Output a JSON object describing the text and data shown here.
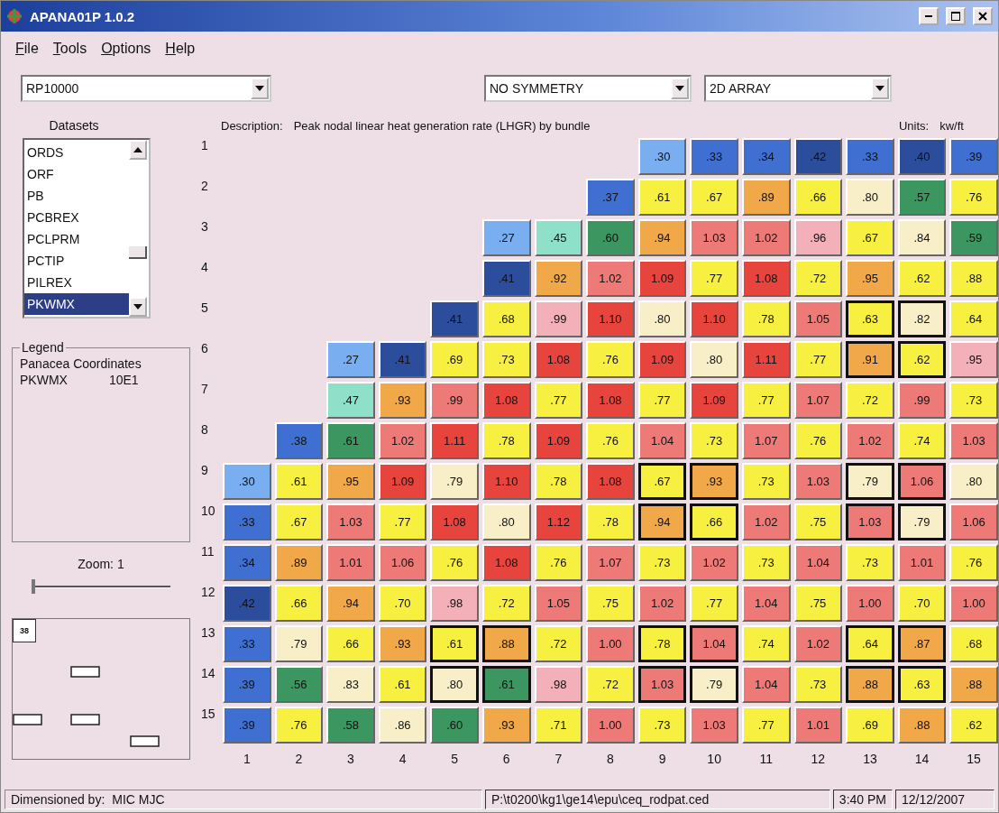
{
  "window": {
    "title": "APANA01P 1.0.2"
  },
  "menu": [
    "File",
    "Tools",
    "Options",
    "Help"
  ],
  "selectors": [
    {
      "value": "RP10000"
    },
    {
      "value": "NO SYMMETRY"
    },
    {
      "value": "2D ARRAY"
    }
  ],
  "datasets": {
    "title": "Datasets",
    "items": [
      {
        "label": "ORDS",
        "selected": false
      },
      {
        "label": "ORF",
        "selected": false
      },
      {
        "label": "PB",
        "selected": false
      },
      {
        "label": "PCBREX",
        "selected": false
      },
      {
        "label": "PCLPRM",
        "selected": false
      },
      {
        "label": "PCTIP",
        "selected": false
      },
      {
        "label": "PILREX",
        "selected": false
      },
      {
        "label": "PKWMX",
        "selected": true
      }
    ]
  },
  "legend": {
    "title": "Legend",
    "heading": "Panacea Coordinates",
    "name": "PKWMX",
    "coordinate": "10E1"
  },
  "zoom": {
    "label": "Zoom:  1",
    "level": 0
  },
  "minimap": {
    "label": "38"
  },
  "description": {
    "label": "Description:",
    "text": "Peak nodal linear heat generation rate (LHGR) by bundle",
    "units_label": "Units:",
    "units": "kw/ft"
  },
  "grid": {
    "rows": [
      {
        "label": "1",
        "cells": [
          "",
          "",
          "",
          "",
          "",
          "",
          "",
          "",
          {
            "value": ".30",
            "color": "#79aef0",
            "outlined": false
          },
          {
            "value": ".33",
            "color": "#3f6fd0",
            "outlined": false
          },
          {
            "value": ".34",
            "color": "#3f6fd0",
            "outlined": false
          },
          {
            "value": ".42",
            "color": "#2c4c9c",
            "outlined": false
          },
          {
            "value": ".33",
            "color": "#3f6fd0",
            "outlined": false
          },
          {
            "value": ".40",
            "color": "#2c4c9c",
            "outlined": false
          },
          {
            "value": ".39",
            "color": "#3f6fd0",
            "outlined": false
          }
        ]
      },
      {
        "label": "2",
        "cells": [
          "",
          "",
          "",
          "",
          "",
          "",
          "",
          {
            "value": ".37",
            "color": "#3f6fd0",
            "outlined": false
          },
          {
            "value": ".61",
            "color": "#f8f040",
            "outlined": false
          },
          {
            "value": ".67",
            "color": "#f8f040",
            "outlined": false
          },
          {
            "value": ".89",
            "color": "#f0a848",
            "outlined": false
          },
          {
            "value": ".66",
            "color": "#f8f040",
            "outlined": false
          },
          {
            "value": ".80",
            "color": "#f8efc8",
            "outlined": false
          },
          {
            "value": ".57",
            "color": "#3c9660",
            "outlined": false
          },
          {
            "value": ".76",
            "color": "#f8f040",
            "outlined": false
          }
        ]
      },
      {
        "label": "3",
        "cells": [
          "",
          "",
          "",
          "",
          "",
          {
            "value": ".27",
            "color": "#79aef0",
            "outlined": false
          },
          {
            "value": ".45",
            "color": "#8ee0c8",
            "outlined": false
          },
          {
            "value": ".60",
            "color": "#3c9660",
            "outlined": false
          },
          {
            "value": ".94",
            "color": "#f0a848",
            "outlined": false
          },
          {
            "value": "1.03",
            "color": "#ee7a78",
            "outlined": false
          },
          {
            "value": "1.02",
            "color": "#ee7a78",
            "outlined": false
          },
          {
            "value": ".96",
            "color": "#f4b0b8",
            "outlined": false
          },
          {
            "value": ".67",
            "color": "#f8f040",
            "outlined": false
          },
          {
            "value": ".84",
            "color": "#f8efc8",
            "outlined": false
          },
          {
            "value": ".59",
            "color": "#3c9660",
            "outlined": false
          }
        ]
      },
      {
        "label": "4",
        "cells": [
          "",
          "",
          "",
          "",
          "",
          {
            "value": ".41",
            "color": "#2c4c9c",
            "outlined": false
          },
          {
            "value": ".92",
            "color": "#f0a848",
            "outlined": false
          },
          {
            "value": "1.02",
            "color": "#ee7a78",
            "outlined": false
          },
          {
            "value": "1.09",
            "color": "#e6443c",
            "outlined": false
          },
          {
            "value": ".77",
            "color": "#f8f040",
            "outlined": false
          },
          {
            "value": "1.08",
            "color": "#e6443c",
            "outlined": false
          },
          {
            "value": ".72",
            "color": "#f8f040",
            "outlined": false
          },
          {
            "value": ".95",
            "color": "#f0a848",
            "outlined": false
          },
          {
            "value": ".62",
            "color": "#f8f040",
            "outlined": false
          },
          {
            "value": ".88",
            "color": "#f8f040",
            "outlined": false
          }
        ]
      },
      {
        "label": "5",
        "cells": [
          "",
          "",
          "",
          "",
          {
            "value": ".41",
            "color": "#2c4c9c",
            "outlined": false
          },
          {
            "value": ".68",
            "color": "#f8f040",
            "outlined": false
          },
          {
            "value": ".99",
            "color": "#f4b0b8",
            "outlined": false
          },
          {
            "value": "1.10",
            "color": "#e6443c",
            "outlined": false
          },
          {
            "value": ".80",
            "color": "#f8efc8",
            "outlined": false
          },
          {
            "value": "1.10",
            "color": "#e6443c",
            "outlined": false
          },
          {
            "value": ".78",
            "color": "#f8f040",
            "outlined": false
          },
          {
            "value": "1.05",
            "color": "#ee7a78",
            "outlined": false
          },
          {
            "value": ".63",
            "color": "#f8f040",
            "outlined": true
          },
          {
            "value": ".82",
            "color": "#f8efc8",
            "outlined": true
          },
          {
            "value": ".64",
            "color": "#f8f040",
            "outlined": false
          }
        ]
      },
      {
        "label": "6",
        "cells": [
          "",
          "",
          {
            "value": ".27",
            "color": "#79aef0",
            "outlined": false
          },
          {
            "value": ".41",
            "color": "#2c4c9c",
            "outlined": false
          },
          {
            "value": ".69",
            "color": "#f8f040",
            "outlined": false
          },
          {
            "value": ".73",
            "color": "#f8f040",
            "outlined": false
          },
          {
            "value": "1.08",
            "color": "#e6443c",
            "outlined": false
          },
          {
            "value": ".76",
            "color": "#f8f040",
            "outlined": false
          },
          {
            "value": "1.09",
            "color": "#e6443c",
            "outlined": false
          },
          {
            "value": ".80",
            "color": "#f8efc8",
            "outlined": false
          },
          {
            "value": "1.11",
            "color": "#e6443c",
            "outlined": false
          },
          {
            "value": ".77",
            "color": "#f8f040",
            "outlined": false
          },
          {
            "value": ".91",
            "color": "#f0a848",
            "outlined": true
          },
          {
            "value": ".62",
            "color": "#f8f040",
            "outlined": true
          },
          {
            "value": ".95",
            "color": "#f4b0b8",
            "outlined": false
          }
        ]
      },
      {
        "label": "7",
        "cells": [
          "",
          "",
          {
            "value": ".47",
            "color": "#8ee0c8",
            "outlined": false
          },
          {
            "value": ".93",
            "color": "#f0a848",
            "outlined": false
          },
          {
            "value": ".99",
            "color": "#ee7a78",
            "outlined": false
          },
          {
            "value": "1.08",
            "color": "#e6443c",
            "outlined": false
          },
          {
            "value": ".77",
            "color": "#f8f040",
            "outlined": false
          },
          {
            "value": "1.08",
            "color": "#e6443c",
            "outlined": false
          },
          {
            "value": ".77",
            "color": "#f8f040",
            "outlined": false
          },
          {
            "value": "1.09",
            "color": "#e6443c",
            "outlined": false
          },
          {
            "value": ".77",
            "color": "#f8f040",
            "outlined": false
          },
          {
            "value": "1.07",
            "color": "#ee7a78",
            "outlined": false
          },
          {
            "value": ".72",
            "color": "#f8f040",
            "outlined": false
          },
          {
            "value": ".99",
            "color": "#ee7a78",
            "outlined": false
          },
          {
            "value": ".73",
            "color": "#f8f040",
            "outlined": false
          }
        ]
      },
      {
        "label": "8",
        "cells": [
          "",
          {
            "value": ".38",
            "color": "#3f6fd0",
            "outlined": false
          },
          {
            "value": ".61",
            "color": "#3c9660",
            "outlined": false
          },
          {
            "value": "1.02",
            "color": "#ee7a78",
            "outlined": false
          },
          {
            "value": "1.11",
            "color": "#e6443c",
            "outlined": false
          },
          {
            "value": ".78",
            "color": "#f8f040",
            "outlined": false
          },
          {
            "value": "1.09",
            "color": "#e6443c",
            "outlined": false
          },
          {
            "value": ".76",
            "color": "#f8f040",
            "outlined": false
          },
          {
            "value": "1.04",
            "color": "#ee7a78",
            "outlined": false
          },
          {
            "value": ".73",
            "color": "#f8f040",
            "outlined": false
          },
          {
            "value": "1.07",
            "color": "#ee7a78",
            "outlined": false
          },
          {
            "value": ".76",
            "color": "#f8f040",
            "outlined": false
          },
          {
            "value": "1.02",
            "color": "#ee7a78",
            "outlined": false
          },
          {
            "value": ".74",
            "color": "#f8f040",
            "outlined": false
          },
          {
            "value": "1.03",
            "color": "#ee7a78",
            "outlined": false
          }
        ]
      },
      {
        "label": "9",
        "cells": [
          {
            "value": ".30",
            "color": "#79aef0",
            "outlined": false
          },
          {
            "value": ".61",
            "color": "#f8f040",
            "outlined": false
          },
          {
            "value": ".95",
            "color": "#f0a848",
            "outlined": false
          },
          {
            "value": "1.09",
            "color": "#e6443c",
            "outlined": false
          },
          {
            "value": ".79",
            "color": "#f8efc8",
            "outlined": false
          },
          {
            "value": "1.10",
            "color": "#e6443c",
            "outlined": false
          },
          {
            "value": ".78",
            "color": "#f8f040",
            "outlined": false
          },
          {
            "value": "1.08",
            "color": "#e6443c",
            "outlined": false
          },
          {
            "value": ".67",
            "color": "#f8f040",
            "outlined": true
          },
          {
            "value": ".93",
            "color": "#f0a848",
            "outlined": true
          },
          {
            "value": ".73",
            "color": "#f8f040",
            "outlined": false
          },
          {
            "value": "1.03",
            "color": "#ee7a78",
            "outlined": false
          },
          {
            "value": ".79",
            "color": "#f8efc8",
            "outlined": true
          },
          {
            "value": "1.06",
            "color": "#ee7a78",
            "outlined": true
          },
          {
            "value": ".80",
            "color": "#f8efc8",
            "outlined": false
          }
        ]
      },
      {
        "label": "10",
        "cells": [
          {
            "value": ".33",
            "color": "#3f6fd0",
            "outlined": false
          },
          {
            "value": ".67",
            "color": "#f8f040",
            "outlined": false
          },
          {
            "value": "1.03",
            "color": "#ee7a78",
            "outlined": false
          },
          {
            "value": ".77",
            "color": "#f8f040",
            "outlined": false
          },
          {
            "value": "1.08",
            "color": "#e6443c",
            "outlined": false
          },
          {
            "value": ".80",
            "color": "#f8efc8",
            "outlined": false
          },
          {
            "value": "1.12",
            "color": "#e6443c",
            "outlined": false
          },
          {
            "value": ".78",
            "color": "#f8f040",
            "outlined": false
          },
          {
            "value": ".94",
            "color": "#f0a848",
            "outlined": true
          },
          {
            "value": ".66",
            "color": "#f8f040",
            "outlined": true
          },
          {
            "value": "1.02",
            "color": "#ee7a78",
            "outlined": false
          },
          {
            "value": ".75",
            "color": "#f8f040",
            "outlined": false
          },
          {
            "value": "1.03",
            "color": "#ee7a78",
            "outlined": true
          },
          {
            "value": ".79",
            "color": "#f8efc8",
            "outlined": true
          },
          {
            "value": "1.06",
            "color": "#ee7a78",
            "outlined": false
          }
        ]
      },
      {
        "label": "11",
        "cells": [
          {
            "value": ".34",
            "color": "#3f6fd0",
            "outlined": false
          },
          {
            "value": ".89",
            "color": "#f0a848",
            "outlined": false
          },
          {
            "value": "1.01",
            "color": "#ee7a78",
            "outlined": false
          },
          {
            "value": "1.06",
            "color": "#ee7a78",
            "outlined": false
          },
          {
            "value": ".76",
            "color": "#f8f040",
            "outlined": false
          },
          {
            "value": "1.08",
            "color": "#e6443c",
            "outlined": false
          },
          {
            "value": ".76",
            "color": "#f8f040",
            "outlined": false
          },
          {
            "value": "1.07",
            "color": "#ee7a78",
            "outlined": false
          },
          {
            "value": ".73",
            "color": "#f8f040",
            "outlined": false
          },
          {
            "value": "1.02",
            "color": "#ee7a78",
            "outlined": false
          },
          {
            "value": ".73",
            "color": "#f8f040",
            "outlined": false
          },
          {
            "value": "1.04",
            "color": "#ee7a78",
            "outlined": false
          },
          {
            "value": ".73",
            "color": "#f8f040",
            "outlined": false
          },
          {
            "value": "1.01",
            "color": "#ee7a78",
            "outlined": false
          },
          {
            "value": ".76",
            "color": "#f8f040",
            "outlined": false
          }
        ]
      },
      {
        "label": "12",
        "cells": [
          {
            "value": ".42",
            "color": "#2c4c9c",
            "outlined": false
          },
          {
            "value": ".66",
            "color": "#f8f040",
            "outlined": false
          },
          {
            "value": ".94",
            "color": "#f0a848",
            "outlined": false
          },
          {
            "value": ".70",
            "color": "#f8f040",
            "outlined": false
          },
          {
            "value": ".98",
            "color": "#f4b0b8",
            "outlined": false
          },
          {
            "value": ".72",
            "color": "#f8f040",
            "outlined": false
          },
          {
            "value": "1.05",
            "color": "#ee7a78",
            "outlined": false
          },
          {
            "value": ".75",
            "color": "#f8f040",
            "outlined": false
          },
          {
            "value": "1.02",
            "color": "#ee7a78",
            "outlined": false
          },
          {
            "value": ".77",
            "color": "#f8f040",
            "outlined": false
          },
          {
            "value": "1.04",
            "color": "#ee7a78",
            "outlined": false
          },
          {
            "value": ".75",
            "color": "#f8f040",
            "outlined": false
          },
          {
            "value": "1.00",
            "color": "#ee7a78",
            "outlined": false
          },
          {
            "value": ".70",
            "color": "#f8f040",
            "outlined": false
          },
          {
            "value": "1.00",
            "color": "#ee7a78",
            "outlined": false
          }
        ]
      },
      {
        "label": "13",
        "cells": [
          {
            "value": ".33",
            "color": "#3f6fd0",
            "outlined": false
          },
          {
            "value": ".79",
            "color": "#f8efc8",
            "outlined": false
          },
          {
            "value": ".66",
            "color": "#f8f040",
            "outlined": false
          },
          {
            "value": ".93",
            "color": "#f0a848",
            "outlined": false
          },
          {
            "value": ".61",
            "color": "#f8f040",
            "outlined": true
          },
          {
            "value": ".88",
            "color": "#f0a848",
            "outlined": true
          },
          {
            "value": ".72",
            "color": "#f8f040",
            "outlined": false
          },
          {
            "value": "1.00",
            "color": "#ee7a78",
            "outlined": false
          },
          {
            "value": ".78",
            "color": "#f8f040",
            "outlined": true
          },
          {
            "value": "1.04",
            "color": "#ee7a78",
            "outlined": true
          },
          {
            "value": ".74",
            "color": "#f8f040",
            "outlined": false
          },
          {
            "value": "1.02",
            "color": "#ee7a78",
            "outlined": false
          },
          {
            "value": ".64",
            "color": "#f8f040",
            "outlined": true
          },
          {
            "value": ".87",
            "color": "#f0a848",
            "outlined": true
          },
          {
            "value": ".68",
            "color": "#f8f040",
            "outlined": false
          }
        ]
      },
      {
        "label": "14",
        "cells": [
          {
            "value": ".39",
            "color": "#3f6fd0",
            "outlined": false
          },
          {
            "value": ".56",
            "color": "#3c9660",
            "outlined": false
          },
          {
            "value": ".83",
            "color": "#f8efc8",
            "outlined": false
          },
          {
            "value": ".61",
            "color": "#f8f040",
            "outlined": false
          },
          {
            "value": ".80",
            "color": "#f8efc8",
            "outlined": true
          },
          {
            "value": ".61",
            "color": "#3c9660",
            "outlined": true
          },
          {
            "value": ".98",
            "color": "#f4b0b8",
            "outlined": false
          },
          {
            "value": ".72",
            "color": "#f8f040",
            "outlined": false
          },
          {
            "value": "1.03",
            "color": "#ee7a78",
            "outlined": true
          },
          {
            "value": ".79",
            "color": "#f8efc8",
            "outlined": true
          },
          {
            "value": "1.04",
            "color": "#ee7a78",
            "outlined": false
          },
          {
            "value": ".73",
            "color": "#f8f040",
            "outlined": false
          },
          {
            "value": ".88",
            "color": "#f0a848",
            "outlined": true
          },
          {
            "value": ".63",
            "color": "#f8f040",
            "outlined": true
          },
          {
            "value": ".88",
            "color": "#f0a848",
            "outlined": false
          }
        ]
      },
      {
        "label": "15",
        "cells": [
          {
            "value": ".39",
            "color": "#3f6fd0",
            "outlined": false
          },
          {
            "value": ".76",
            "color": "#f8f040",
            "outlined": false
          },
          {
            "value": ".58",
            "color": "#3c9660",
            "outlined": false
          },
          {
            "value": ".86",
            "color": "#f8efc8",
            "outlined": false
          },
          {
            "value": ".60",
            "color": "#3c9660",
            "outlined": false
          },
          {
            "value": ".93",
            "color": "#f0a848",
            "outlined": false
          },
          {
            "value": ".71",
            "color": "#f8f040",
            "outlined": false
          },
          {
            "value": "1.00",
            "color": "#ee7a78",
            "outlined": false
          },
          {
            "value": ".73",
            "color": "#f8f040",
            "outlined": false
          },
          {
            "value": "1.03",
            "color": "#ee7a78",
            "outlined": false
          },
          {
            "value": ".77",
            "color": "#f8f040",
            "outlined": false
          },
          {
            "value": "1.01",
            "color": "#ee7a78",
            "outlined": false
          },
          {
            "value": ".69",
            "color": "#f8f040",
            "outlined": false
          },
          {
            "value": ".88",
            "color": "#f0a848",
            "outlined": false
          },
          {
            "value": ".62",
            "color": "#f8f040",
            "outlined": false
          }
        ]
      }
    ],
    "bottom_axis_labels": [
      "1",
      "2",
      "3",
      "4",
      "5",
      "6",
      "7",
      "8",
      "9",
      "10",
      "11",
      "12",
      "13",
      "14",
      "15"
    ]
  },
  "status_bar": {
    "dimensioned_label": "Dimensioned by:",
    "dimensioned_by": "MIC MJC",
    "path": "P:\\t0200\\kg1\\ge14\\epu\\ceq_rodpat.ced",
    "time": "3:40 PM",
    "date": "12/12/2007"
  }
}
